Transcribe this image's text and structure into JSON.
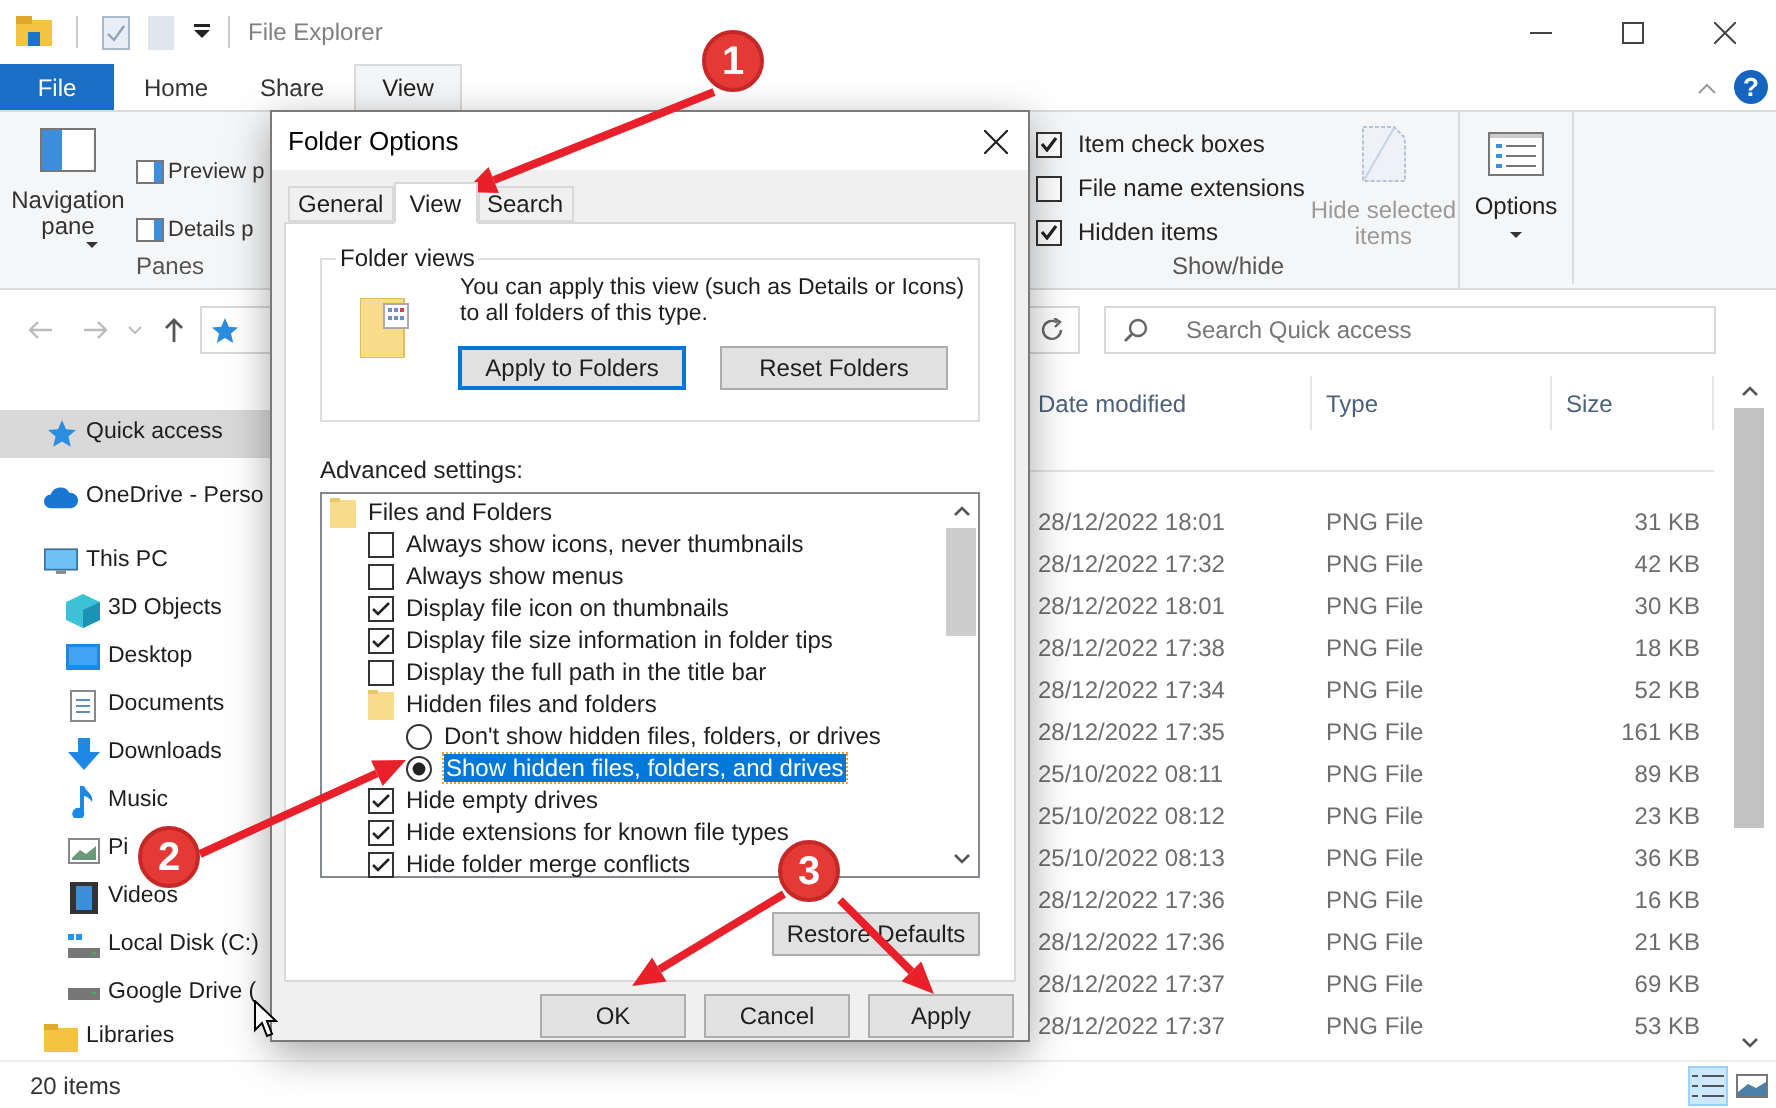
{
  "window": {
    "title": "File Explorer"
  },
  "ribbon_tabs": [
    {
      "label": "File",
      "selected": false,
      "kind": "file"
    },
    {
      "label": "Home",
      "selected": false,
      "kind": "tab"
    },
    {
      "label": "Share",
      "selected": false,
      "kind": "tab"
    },
    {
      "label": "View",
      "selected": true,
      "kind": "tab"
    }
  ],
  "help_glyph": "?",
  "ribbon": {
    "panes": {
      "label": "Panes",
      "navigation_pane": "Navigation pane",
      "preview_pane": "Preview p",
      "details_pane": "Details p"
    },
    "show_hide": {
      "label": "Show/hide",
      "checkboxes": [
        {
          "label": "Item check boxes",
          "checked": true
        },
        {
          "label": "File name extensions",
          "checked": false
        },
        {
          "label": "Hidden items",
          "checked": true
        }
      ],
      "hide_selected": {
        "label": "Hide selected items",
        "disabled": true
      }
    },
    "options": {
      "label": "Options"
    }
  },
  "search": {
    "placeholder": "Search Quick access"
  },
  "nav": [
    {
      "label": "Quick access",
      "selected": true
    },
    {
      "label": "OneDrive - Perso",
      "selected": false
    },
    {
      "label": "This PC",
      "selected": false,
      "children": [
        {
          "label": "3D Objects",
          "selected": false
        },
        {
          "label": "Desktop",
          "selected": false
        },
        {
          "label": "Documents",
          "selected": false
        },
        {
          "label": "Downloads",
          "selected": false
        },
        {
          "label": "Music",
          "selected": false
        },
        {
          "label": "Pi",
          "selected": false
        },
        {
          "label": "Videos",
          "selected": false
        },
        {
          "label": "Local Disk (C:)",
          "selected": false
        },
        {
          "label": "Google Drive (",
          "selected": false
        }
      ]
    },
    {
      "label": "Libraries",
      "selected": false
    }
  ],
  "table": {
    "columns": [
      "Date modified",
      "Type",
      "Size"
    ],
    "rows": [
      {
        "date_modified": "28/12/2022 18:01",
        "type": "PNG File",
        "size": "31 KB"
      },
      {
        "date_modified": "28/12/2022 17:32",
        "type": "PNG File",
        "size": "42 KB"
      },
      {
        "date_modified": "28/12/2022 18:01",
        "type": "PNG File",
        "size": "30 KB"
      },
      {
        "date_modified": "28/12/2022 17:38",
        "type": "PNG File",
        "size": "18 KB"
      },
      {
        "date_modified": "28/12/2022 17:34",
        "type": "PNG File",
        "size": "52 KB"
      },
      {
        "date_modified": "28/12/2022 17:35",
        "type": "PNG File",
        "size": "161 KB"
      },
      {
        "date_modified": "25/10/2022 08:11",
        "type": "PNG File",
        "size": "89 KB"
      },
      {
        "date_modified": "25/10/2022 08:12",
        "type": "PNG File",
        "size": "23 KB"
      },
      {
        "date_modified": "25/10/2022 08:13",
        "type": "PNG File",
        "size": "36 KB"
      },
      {
        "date_modified": "28/12/2022 17:36",
        "type": "PNG File",
        "size": "16 KB"
      },
      {
        "date_modified": "28/12/2022 17:36",
        "type": "PNG File",
        "size": "21 KB"
      },
      {
        "date_modified": "28/12/2022 17:37",
        "type": "PNG File",
        "size": "69 KB"
      },
      {
        "date_modified": "28/12/2022 17:37",
        "type": "PNG File",
        "size": "53 KB"
      }
    ]
  },
  "status_bar": {
    "item_count": "20 items",
    "view_buttons": [
      {
        "kind": "details",
        "selected": true
      },
      {
        "kind": "thumbnails",
        "selected": false
      }
    ]
  },
  "dialog": {
    "title": "Folder Options",
    "tabs": [
      {
        "label": "General",
        "selected": false
      },
      {
        "label": "View",
        "selected": true
      },
      {
        "label": "Search",
        "selected": false
      }
    ],
    "folder_views": {
      "legend": "Folder views",
      "description": "You can apply this view (such as Details or Icons) to all folders of this type.",
      "buttons": [
        {
          "label": "Apply to Folders",
          "focused": true
        },
        {
          "label": "Reset Folders",
          "focused": false
        }
      ]
    },
    "advanced_label": "Advanced settings:",
    "tree": [
      {
        "kind": "folder",
        "label": "Files and Folders",
        "selected": false,
        "children": [
          {
            "kind": "checkbox",
            "label": "Always show icons, never thumbnails",
            "checked": false,
            "selected": false
          },
          {
            "kind": "checkbox",
            "label": "Always show menus",
            "checked": false,
            "selected": false
          },
          {
            "kind": "checkbox",
            "label": "Display file icon on thumbnails",
            "checked": true,
            "selected": false
          },
          {
            "kind": "checkbox",
            "label": "Display file size information in folder tips",
            "checked": true,
            "selected": false
          },
          {
            "kind": "checkbox",
            "label": "Display the full path in the title bar",
            "checked": false,
            "selected": false
          },
          {
            "kind": "folder",
            "label": "Hidden files and folders",
            "selected": false,
            "children": [
              {
                "kind": "radio",
                "label": "Don't show hidden files, folders, or drives",
                "checked": false,
                "selected": false
              },
              {
                "kind": "radio",
                "label": "Show hidden files, folders, and drives",
                "checked": true,
                "selected": true
              }
            ]
          },
          {
            "kind": "checkbox",
            "label": "Hide empty drives",
            "checked": true,
            "selected": false
          },
          {
            "kind": "checkbox",
            "label": "Hide extensions for known file types",
            "checked": true,
            "selected": false
          },
          {
            "kind": "checkbox",
            "label": "Hide folder merge conflicts",
            "checked": true,
            "selected": false
          }
        ]
      }
    ],
    "restore_button": "Restore Defaults",
    "buttons": [
      "OK",
      "Cancel",
      "Apply"
    ]
  },
  "annotations": [
    {
      "label": "1"
    },
    {
      "label": "2"
    },
    {
      "label": "3"
    }
  ]
}
